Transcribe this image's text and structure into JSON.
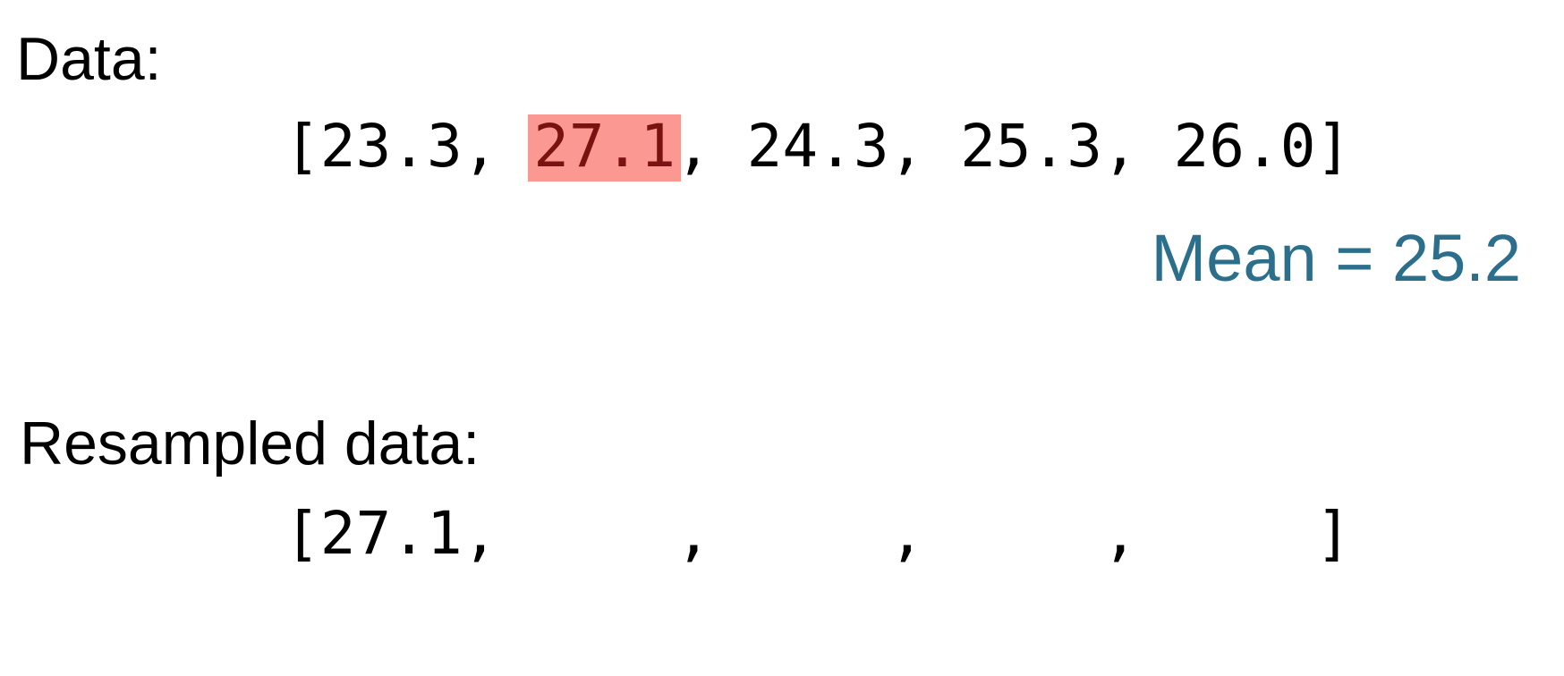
{
  "data_section": {
    "label": "Data:",
    "open_bracket": "[",
    "close_bracket": "]",
    "separator": ", ",
    "values": [
      "23.3",
      "27.1",
      "24.3",
      "25.3",
      "26.0"
    ],
    "highlighted_value": "27.1",
    "highlight_color": "#fa9891",
    "highlight_text_color": "#7a1212"
  },
  "mean": {
    "label": "Mean",
    "equals": "=",
    "value": "25.2",
    "color": "#2b6f8c"
  },
  "resampled_section": {
    "label": "Resampled data:",
    "open_bracket": "[",
    "close_bracket": "]",
    "separator": ", ",
    "values": [
      "27.1",
      "",
      "",
      "",
      ""
    ]
  }
}
